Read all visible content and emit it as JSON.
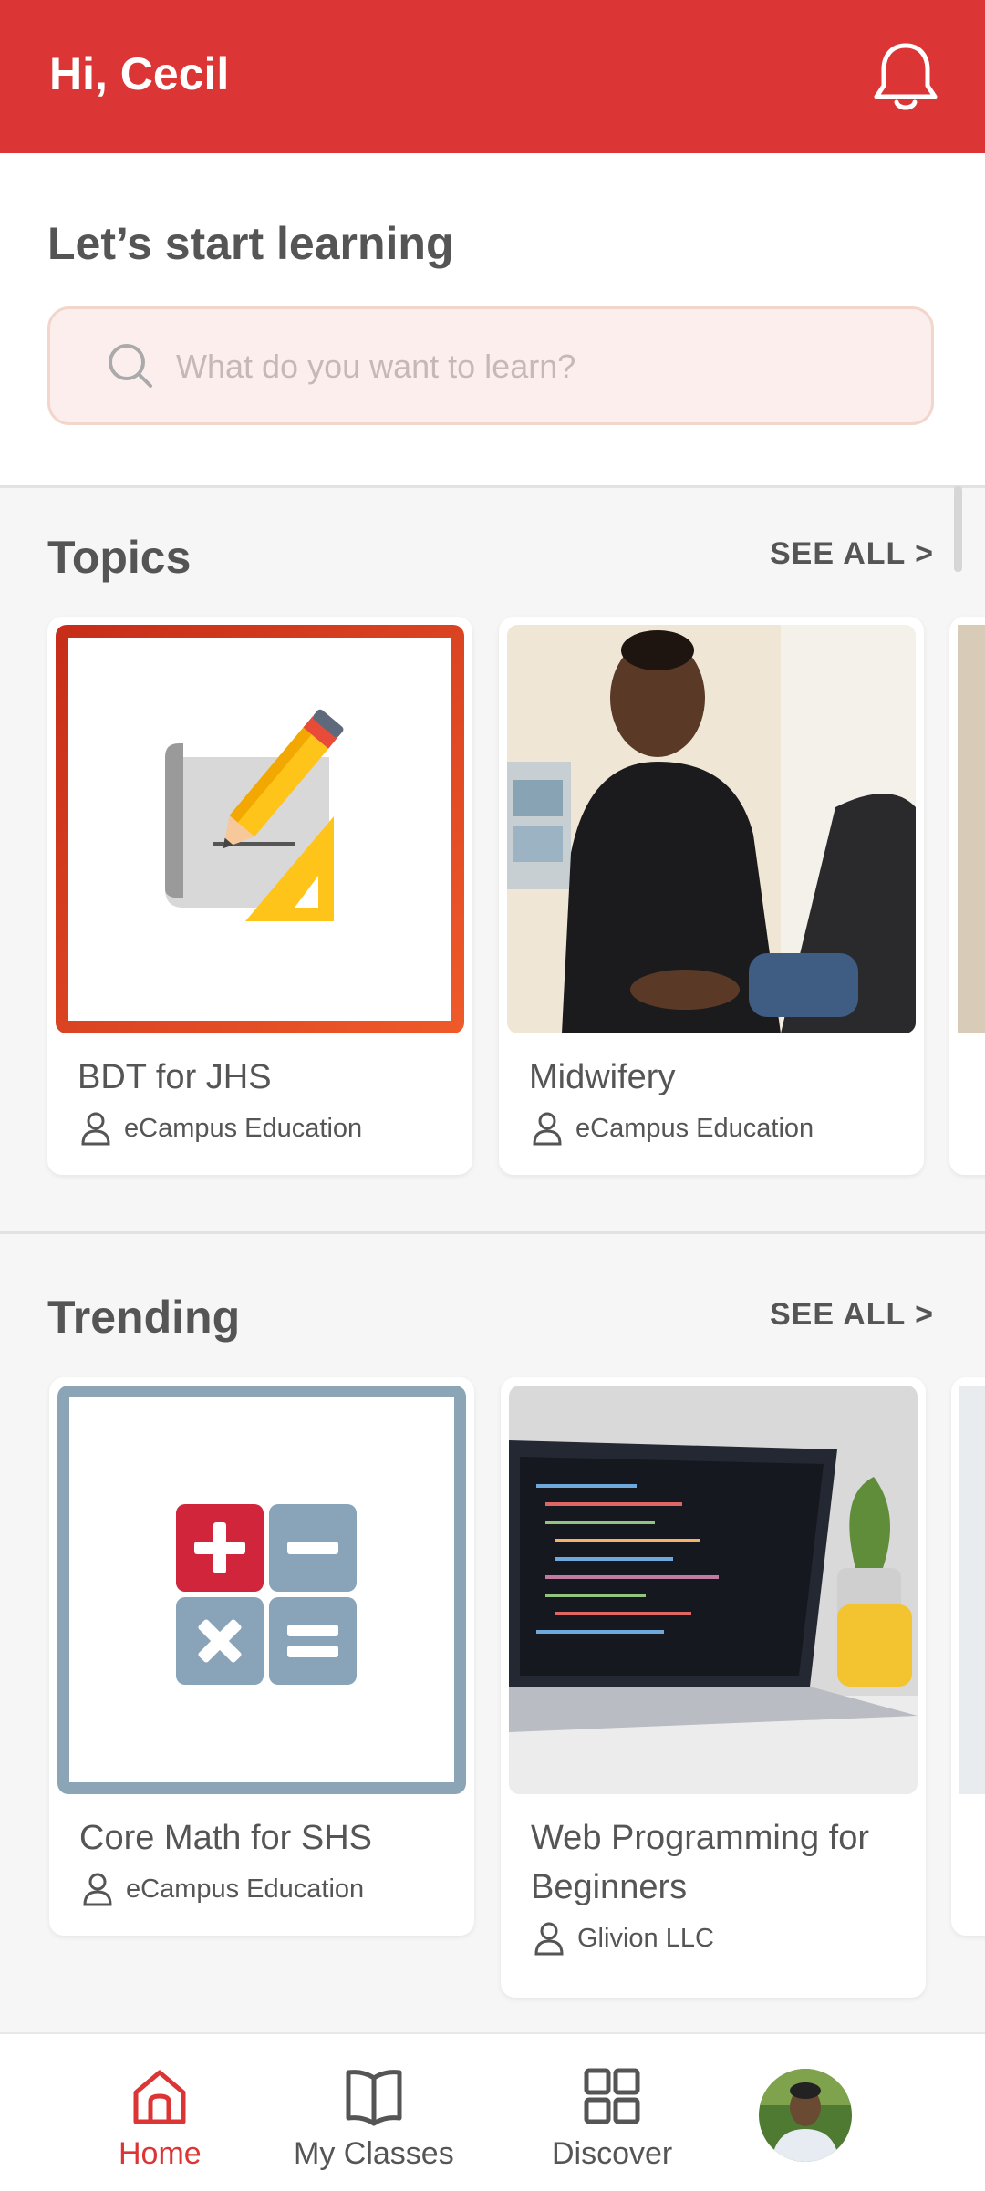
{
  "header": {
    "greeting": "Hi, Cecil"
  },
  "intro": {
    "title": "Let’s start learning",
    "search_placeholder": "What do you want to learn?"
  },
  "topics": {
    "title": "Topics",
    "see_all": "SEE ALL >",
    "cards": [
      {
        "name": "BDT for JHS",
        "author": "eCampus Education"
      },
      {
        "name": "Midwifery",
        "author": "eCampus Education"
      }
    ]
  },
  "trending": {
    "title": "Trending",
    "see_all": "SEE ALL >",
    "cards": [
      {
        "name": "Core Math for SHS",
        "author": "eCampus Education"
      },
      {
        "name": "Web Programming for Beginners",
        "author": "Glivion LLC"
      }
    ]
  },
  "nav": {
    "items": [
      {
        "label": "Home",
        "icon": "home-icon",
        "active": true
      },
      {
        "label": "My Classes",
        "icon": "book-icon",
        "active": false
      },
      {
        "label": "Discover",
        "icon": "grid-icon",
        "active": false
      }
    ]
  },
  "colors": {
    "brand": "#dc3535",
    "text": "#555555",
    "search_bg": "#fdeeee"
  }
}
